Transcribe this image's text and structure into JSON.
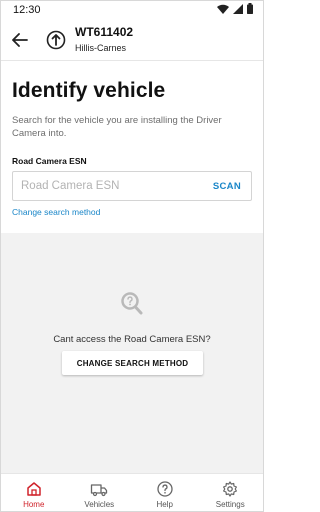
{
  "status_bar": {
    "time": "12:30"
  },
  "header": {
    "vehicle_id": "WT611402",
    "vehicle_subtitle": "Hillis-Carnes"
  },
  "main": {
    "title": "Identify vehicle",
    "description": "Search for the vehicle you are installing the Driver Camera into.",
    "field_label": "Road Camera ESN",
    "search_placeholder": "Road Camera ESN",
    "search_value": "",
    "scan_label": "SCAN",
    "change_link": "Change search method"
  },
  "empty_state": {
    "message": "Cant access the Road Camera ESN?",
    "button_label": "CHANGE SEARCH METHOD"
  },
  "bottom_nav": {
    "items": [
      {
        "label": "Home",
        "icon": "home-icon",
        "active": true
      },
      {
        "label": "Vehicles",
        "icon": "truck-icon",
        "active": false
      },
      {
        "label": "Help",
        "icon": "help-icon",
        "active": false
      },
      {
        "label": "Settings",
        "icon": "gear-icon",
        "active": false
      }
    ]
  },
  "colors": {
    "accent_blue": "#1a86c8",
    "active_red": "#d0232b",
    "grey_bg": "#f2f2f2"
  }
}
